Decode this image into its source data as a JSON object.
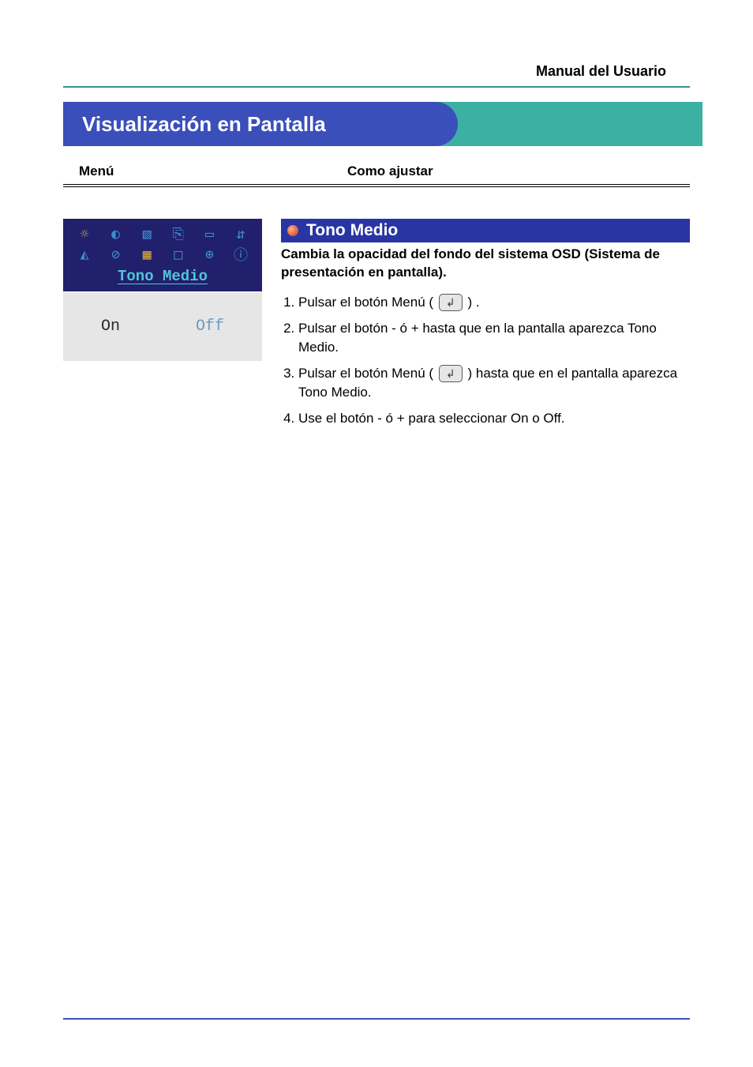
{
  "header": {
    "title": "Manual del Usuario"
  },
  "page_title": "Visualización en Pantalla",
  "columns": {
    "menu_label": "Menú",
    "adjust_label": "Como ajustar"
  },
  "osd": {
    "menu_name": "Tono Medio",
    "option_on": "On",
    "option_off": "Off",
    "icons_row1": [
      "☼",
      "◐",
      "▧",
      "⎘",
      "▭",
      "⇵"
    ],
    "icons_row2": [
      "◭",
      "⊘",
      "▦",
      "□",
      "⊕",
      "ⓘ"
    ]
  },
  "section": {
    "name": "Tono Medio",
    "description": "Cambia la opacidad del fondo del sistema OSD (Sistema de presentación en pantalla).",
    "steps": [
      {
        "pre": "Pulsar el botón Menú ( ",
        "icon": true,
        "post": " ) ."
      },
      {
        "pre": "Pulsar el botón - ó + hasta que en la pantalla aparezca Tono Medio.",
        "icon": false,
        "post": ""
      },
      {
        "pre": "Pulsar el botón Menú ( ",
        "icon": true,
        "post": " ) hasta que en el pantalla aparezca Tono Medio."
      },
      {
        "pre": "Use el botón - ó + para seleccionar On o Off.",
        "icon": false,
        "post": ""
      }
    ]
  }
}
